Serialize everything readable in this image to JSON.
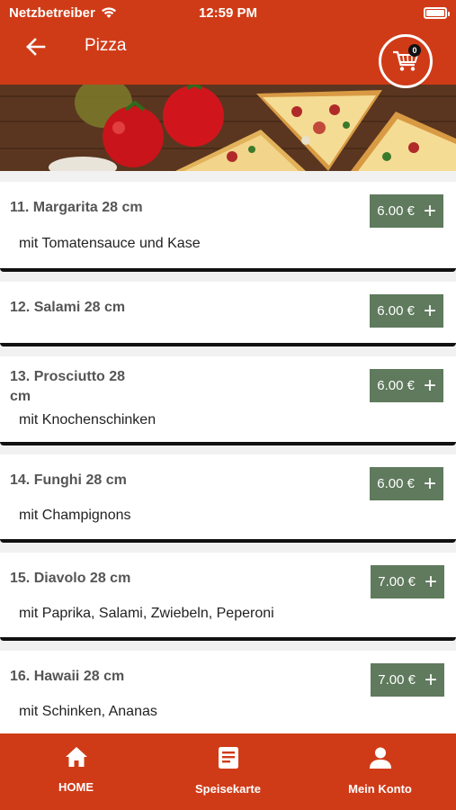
{
  "status": {
    "carrier": "Netzbetreiber",
    "time": "12:59 PM"
  },
  "header": {
    "title": "Pizza",
    "cart_count": "0"
  },
  "items": [
    {
      "name": "11. Margarita 28 cm",
      "desc": "mit Tomatensauce und Kase",
      "price": "6.00 €"
    },
    {
      "name": "12. Salami 28 cm",
      "desc": "",
      "price": "6.00 €"
    },
    {
      "name": "13. Prosciutto 28 cm",
      "desc": "mit Knochenschinken",
      "price": "6.00 €"
    },
    {
      "name": "14. Funghi 28 cm",
      "desc": "mit Champignons",
      "price": "6.00 €"
    },
    {
      "name": "15. Diavolo 28 cm",
      "desc": "mit Paprika, Salami, Zwiebeln, Peperoni",
      "price": "7.00 €"
    },
    {
      "name": "16. Hawaii 28 cm",
      "desc": "mit Schinken, Ananas",
      "price": "7.00 €"
    }
  ],
  "nav": [
    {
      "label": "HOME",
      "icon": "home-icon"
    },
    {
      "label": "Speisekarte",
      "icon": "menu-list-icon"
    },
    {
      "label": "Mein Konto",
      "icon": "person-icon"
    }
  ],
  "colors": {
    "brand": "#d03b17",
    "price": "#5f7a5d"
  }
}
